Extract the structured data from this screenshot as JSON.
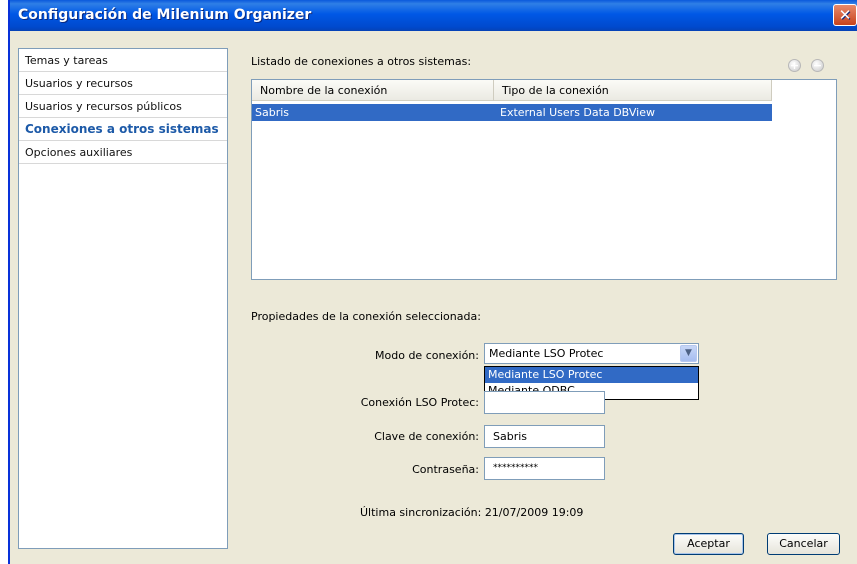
{
  "window": {
    "title": "Configuración de Milenium Organizer",
    "close_glyph": "✕"
  },
  "sidebar": {
    "items": [
      {
        "label": "Temas y tareas"
      },
      {
        "label": "Usuarios y recursos"
      },
      {
        "label": "Usuarios y recursos públicos"
      },
      {
        "label": "Conexiones a otros sistemas"
      },
      {
        "label": "Opciones auxiliares"
      }
    ],
    "active_index": 3
  },
  "connections": {
    "title": "Listado de conexiones a otros sistemas:",
    "columns": [
      "Nombre de la conexión",
      "Tipo de la conexión"
    ],
    "rows": [
      {
        "name": "Sabris",
        "type": "External Users Data DBView"
      }
    ]
  },
  "properties": {
    "title": "Propiedades de la conexión seleccionada:",
    "mode_label": "Modo de conexión:",
    "mode_value": "Mediante LSO Protec",
    "mode_options": [
      "Mediante LSO Protec",
      "Mediante ODBC"
    ],
    "lso_label": "Conexión LSO Protec:",
    "lso_value": "",
    "key_label": "Clave de conexión:",
    "key_value": "Sabris",
    "password_label": "Contraseña:",
    "password_value": "**********"
  },
  "sync": {
    "label": "Última sincronización:",
    "value": "21/07/2009 19:09"
  },
  "buttons": {
    "ok": "Aceptar",
    "cancel": "Cancelar"
  },
  "colors": {
    "accent": "#316ac5",
    "titlebar": "#0058e6",
    "active_sidebar": "#1d5aa8"
  }
}
